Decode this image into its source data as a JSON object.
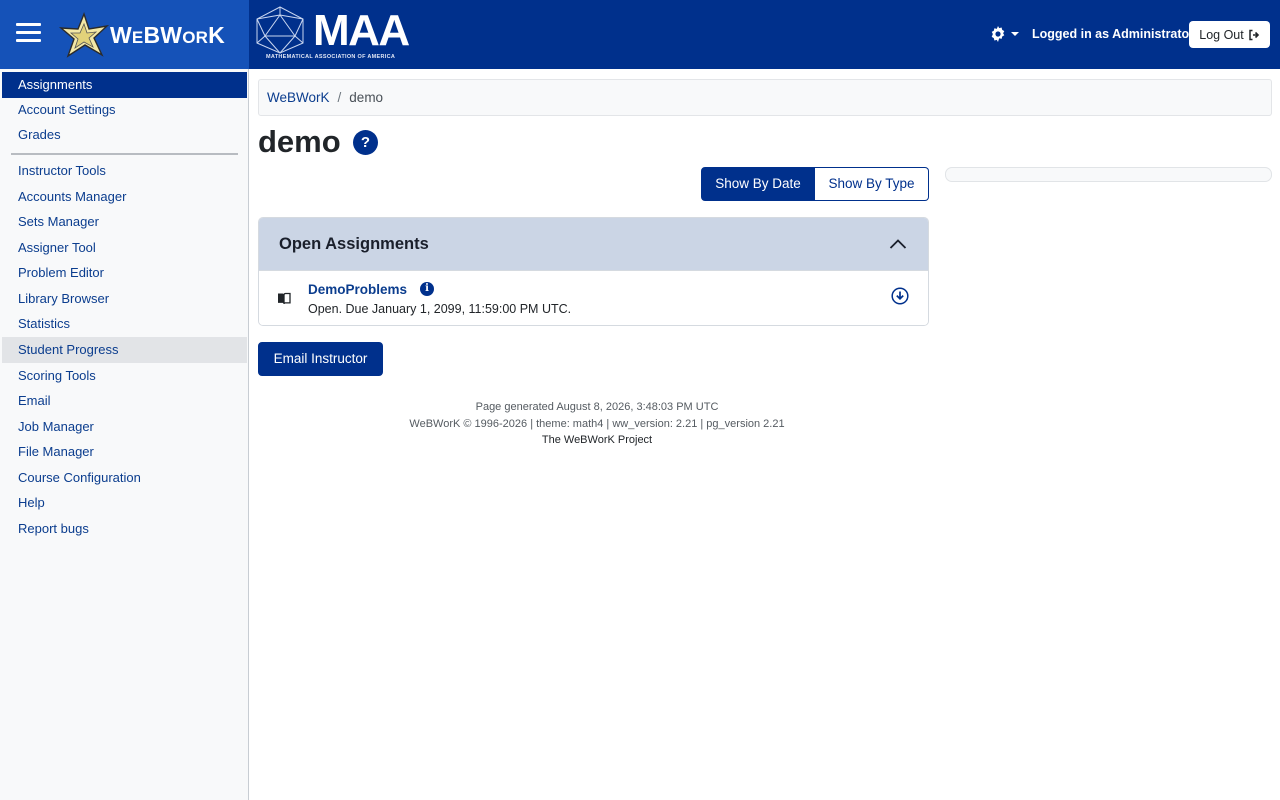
{
  "header": {
    "brand": "WeBWorK",
    "brand_parts": [
      "W",
      "E",
      "BW",
      "OR",
      "K"
    ],
    "maa_title": "MAA",
    "maa_subtitle": "MATHEMATICAL ASSOCIATION OF AMERICA",
    "logged_in_text": "Logged in as Administrator.",
    "logout_label": "Log Out",
    "colors": {
      "bar": "#00308c",
      "brand_panel": "#1552b8"
    }
  },
  "sidebar": {
    "items": [
      {
        "label": "Assignments",
        "state": "active"
      },
      {
        "label": "Account Settings"
      },
      {
        "label": "Grades"
      },
      {
        "label": "Instructor Tools"
      },
      {
        "label": "Accounts Manager"
      },
      {
        "label": "Sets Manager"
      },
      {
        "label": "Assigner Tool"
      },
      {
        "label": "Problem Editor"
      },
      {
        "label": "Library Browser"
      },
      {
        "label": "Statistics"
      },
      {
        "label": "Student Progress",
        "state": "hover"
      },
      {
        "label": "Scoring Tools"
      },
      {
        "label": "Email"
      },
      {
        "label": "Job Manager"
      },
      {
        "label": "File Manager"
      },
      {
        "label": "Course Configuration"
      },
      {
        "label": "Help"
      },
      {
        "label": "Report bugs"
      }
    ]
  },
  "breadcrumb": {
    "root": "WeBWorK",
    "separator": "/",
    "current": "demo"
  },
  "main": {
    "title": "demo",
    "help_glyph": "?",
    "view_toggle": {
      "by_date": "Show By Date",
      "by_type": "Show By Type",
      "selected": "by_date"
    },
    "section": {
      "title": "Open Assignments",
      "sets": [
        {
          "name": "DemoProblems",
          "status": "Open. Due January 1, 2099, 11:59:00 PM UTC."
        }
      ]
    },
    "email_button": "Email Instructor"
  },
  "footer": {
    "generated": "Page generated August 8, 2026, 3:48:03 PM UTC",
    "version": "WeBWorK © 1996-2026 | theme: math4 | ww_version: 2.21 | pg_version 2.21",
    "project": "The WeBWorK Project"
  }
}
